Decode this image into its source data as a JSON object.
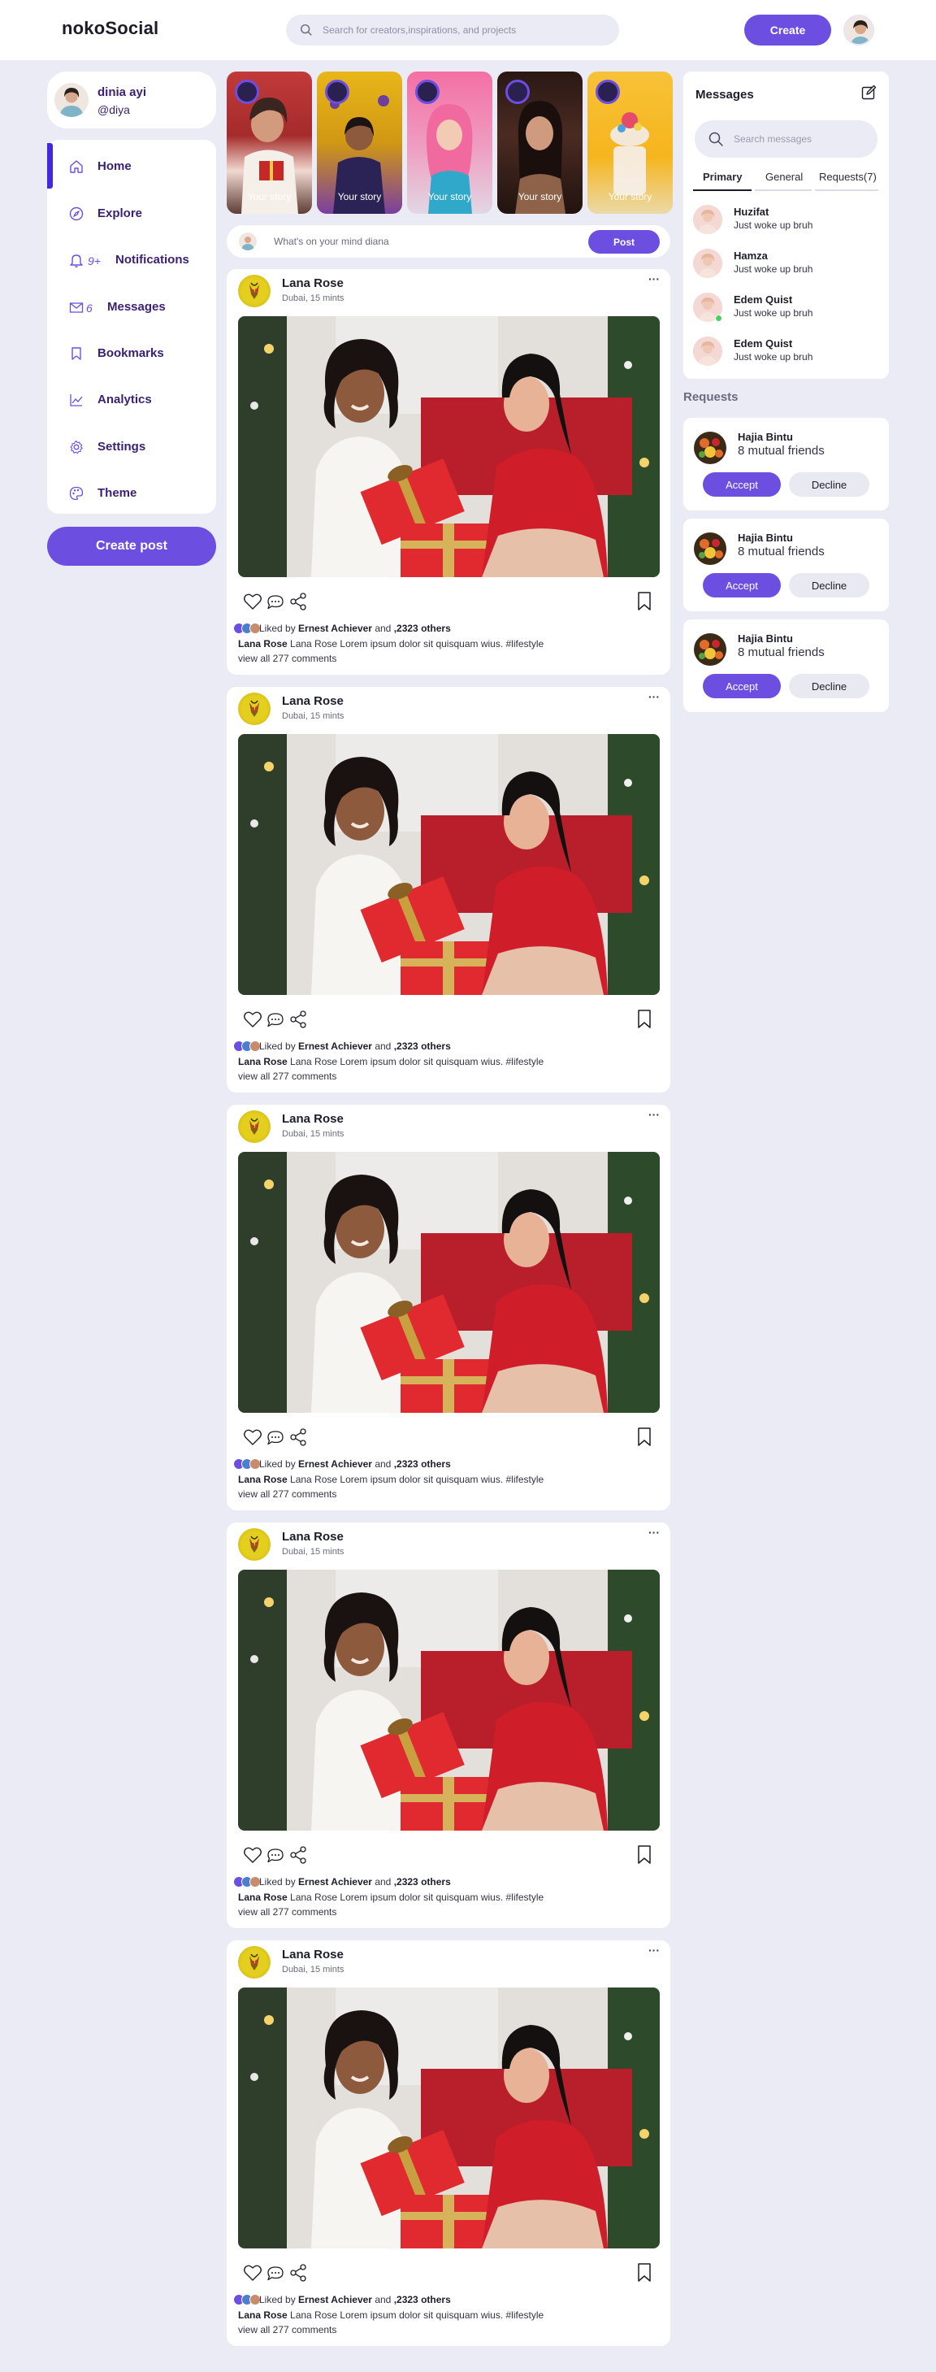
{
  "app": {
    "logo": "nokoSocial"
  },
  "nav": {
    "search_placeholder": "Search for creators,inspirations, and projects",
    "create_label": "Create"
  },
  "profile": {
    "name": "dinia ayi",
    "handle": "@diya"
  },
  "menu": {
    "items": [
      {
        "label": "Home",
        "icon": "home-icon",
        "active": true
      },
      {
        "label": "Explore",
        "icon": "compass-icon"
      },
      {
        "label": "Notifications",
        "icon": "bell-icon",
        "badge": "9+"
      },
      {
        "label": "Messages",
        "icon": "envelope-icon",
        "badge": "6"
      },
      {
        "label": "Bookmarks",
        "icon": "bookmark-icon"
      },
      {
        "label": "Analytics",
        "icon": "chart-line-icon"
      },
      {
        "label": "Settings",
        "icon": "gear-icon"
      },
      {
        "label": "Theme",
        "icon": "palette-icon"
      }
    ]
  },
  "create_post_label": "Create post",
  "stories": [
    {
      "label": "Your story"
    },
    {
      "label": "Your story"
    },
    {
      "label": "Your story"
    },
    {
      "label": "Your story"
    },
    {
      "label": "Your story"
    }
  ],
  "composer": {
    "placeholder": "What's on your mind diana",
    "button": "Post"
  },
  "posts": [
    {
      "author": "Lana Rose",
      "location": "Dubai, 15 mints",
      "liked_by": "Ernest Achiever",
      "liked_and": "and",
      "liked_others": ",2323 others",
      "liked_prefix": "Liked by",
      "caption_author": "Lana Rose",
      "caption": "Lana Rose Lorem ipsum dolor sit quisquam wius. #lifestyle",
      "comments": "view all 277 comments"
    },
    {
      "author": "Lana Rose",
      "location": "Dubai, 15 mints",
      "liked_by": "Ernest Achiever",
      "liked_and": "and",
      "liked_others": ",2323 others",
      "liked_prefix": "Liked by",
      "caption_author": "Lana Rose",
      "caption": "Lana Rose Lorem ipsum dolor sit quisquam wius. #lifestyle",
      "comments": "view all 277 comments"
    },
    {
      "author": "Lana Rose",
      "location": "Dubai, 15 mints",
      "liked_by": "Ernest Achiever",
      "liked_and": "and",
      "liked_others": ",2323 others",
      "liked_prefix": "Liked by",
      "caption_author": "Lana Rose",
      "caption": "Lana Rose Lorem ipsum dolor sit quisquam wius. #lifestyle",
      "comments": "view all 277 comments"
    },
    {
      "author": "Lana Rose",
      "location": "Dubai, 15 mints",
      "liked_by": "Ernest Achiever",
      "liked_and": "and",
      "liked_others": ",2323 others",
      "liked_prefix": "Liked by",
      "caption_author": "Lana Rose",
      "caption": "Lana Rose Lorem ipsum dolor sit quisquam wius. #lifestyle",
      "comments": "view all 277 comments"
    },
    {
      "author": "Lana Rose",
      "location": "Dubai, 15 mints",
      "liked_by": "Ernest Achiever",
      "liked_and": "and",
      "liked_others": ",2323 others",
      "liked_prefix": "Liked by",
      "caption_author": "Lana Rose",
      "caption": "Lana Rose Lorem ipsum dolor sit quisquam wius. #lifestyle",
      "comments": "view all 277 comments"
    }
  ],
  "messages": {
    "title": "Messages",
    "search_placeholder": "Search messages",
    "tabs": [
      {
        "label": "Primary",
        "active": true
      },
      {
        "label": "General"
      },
      {
        "label": "Requests(7)"
      }
    ],
    "conversations": [
      {
        "name": "Huzifat",
        "message": "Just woke up bruh",
        "online": false
      },
      {
        "name": "Hamza",
        "message": "Just woke up bruh",
        "online": false
      },
      {
        "name": "Edem Quist",
        "message": "Just woke up bruh",
        "online": true
      },
      {
        "name": "Edem Quist",
        "message": "Just woke up bruh",
        "online": false
      }
    ]
  },
  "requests": {
    "title": "Requests",
    "items": [
      {
        "name": "Hajia Bintu",
        "mutual": "8 mutual friends",
        "accept": "Accept",
        "decline": "Decline"
      },
      {
        "name": "Hajia Bintu",
        "mutual": "8 mutual friends",
        "accept": "Accept",
        "decline": "Decline"
      },
      {
        "name": "Hajia Bintu",
        "mutual": "8 mutual friends",
        "accept": "Accept",
        "decline": "Decline"
      }
    ]
  },
  "colors": {
    "accent": "#6c4fe0",
    "background": "#ebebf6",
    "menu_active_bar": "#4229e0",
    "text_purple": "#3b1f72"
  }
}
